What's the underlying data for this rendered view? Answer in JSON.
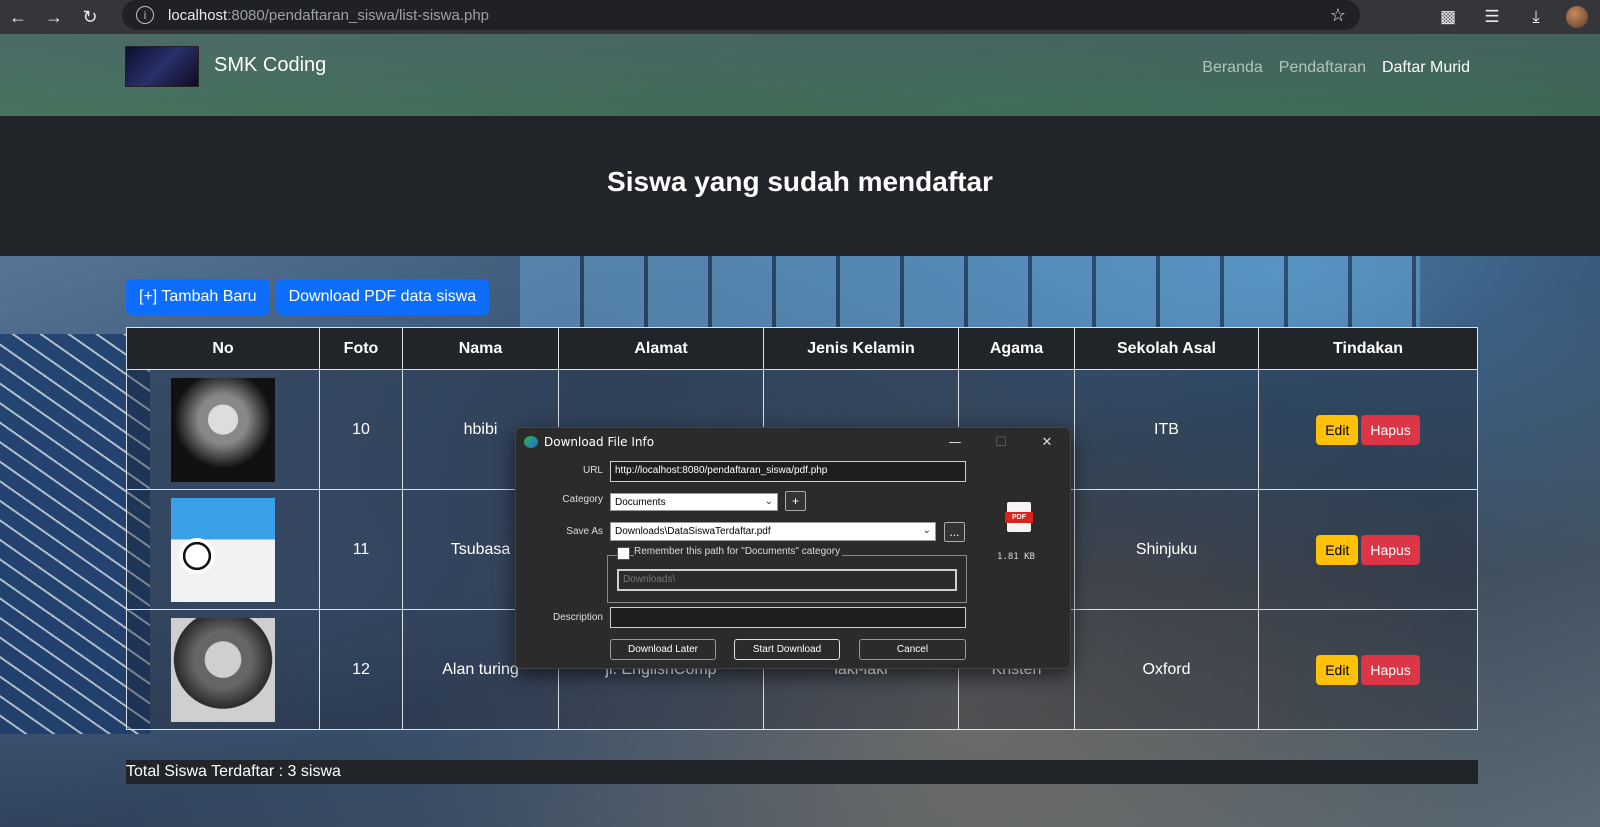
{
  "browser": {
    "url_host": "localhost",
    "url_rest": ":8080/pendaftaran_siswa/list-siswa.php"
  },
  "navbar": {
    "brand": "SMK Coding",
    "links": [
      {
        "label": "Beranda",
        "active": false
      },
      {
        "label": "Pendaftaran",
        "active": false
      },
      {
        "label": "Daftar Murid",
        "active": true
      }
    ]
  },
  "header": {
    "title": "Siswa yang sudah mendaftar"
  },
  "actions": {
    "add_label": "[+] Tambah Baru",
    "pdf_label": "Download PDF data siswa"
  },
  "table": {
    "columns": [
      "No",
      "Foto",
      "Nama",
      "Alamat",
      "Jenis Kelamin",
      "Agama",
      "Sekolah Asal",
      "Tindakan"
    ],
    "rows": [
      {
        "no": "10",
        "nama": "hbibi",
        "alamat": "",
        "jk": "",
        "agama": "",
        "sekolah": "ITB"
      },
      {
        "no": "11",
        "nama": "Tsubasa",
        "alamat": "",
        "jk": "",
        "agama": "",
        "sekolah": "Shinjuku"
      },
      {
        "no": "12",
        "nama": "Alan turing",
        "alamat": "jl. EnglishComp",
        "jk": "laki-laki",
        "agama": "Kristen",
        "sekolah": "Oxford"
      }
    ],
    "edit_label": "Edit",
    "hapus_label": "Hapus"
  },
  "footer": {
    "total": "Total Siswa Terdaftar : 3 siswa"
  },
  "dialog": {
    "title": "Download File Info",
    "url_label": "URL",
    "url_value": "http://localhost:8080/pendaftaran_siswa/pdf.php",
    "category_label": "Category",
    "category_value": "Documents",
    "saveas_label": "Save As",
    "saveas_value": "Downloads\\DataSiswaTerdaftar.pdf",
    "remember_label": "Remember this path for \"Documents\" category",
    "remember_path": "Downloads\\",
    "description_label": "Description",
    "description_value": "",
    "file_size": "1.81  KB",
    "pdf_tag": "PDF",
    "buttons": {
      "later": "Download Later",
      "start": "Start Download",
      "cancel": "Cancel"
    }
  }
}
